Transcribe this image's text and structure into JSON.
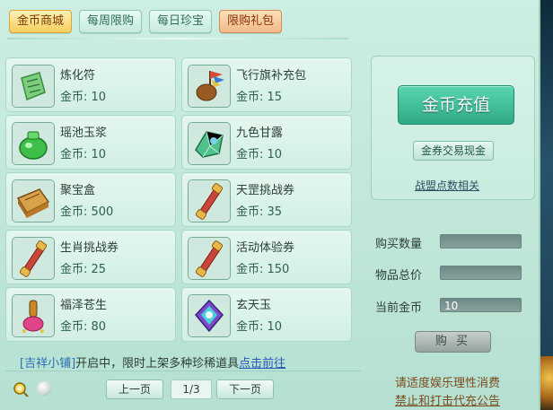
{
  "tabs": [
    {
      "label": "金币商城",
      "active": true
    },
    {
      "label": "每周限购",
      "active": false
    },
    {
      "label": "每日珍宝",
      "active": false
    },
    {
      "label": "限购礼包",
      "active": false
    }
  ],
  "items": [
    {
      "name": "炼化符",
      "price": "金币: 10",
      "icon": "talisman-icon"
    },
    {
      "name": "飞行旗补充包",
      "price": "金币: 15",
      "icon": "flag-pack-icon"
    },
    {
      "name": "瑶池玉浆",
      "price": "金币: 10",
      "icon": "jade-jar-icon"
    },
    {
      "name": "九色甘露",
      "price": "金币: 10",
      "icon": "dew-crystal-icon"
    },
    {
      "name": "聚宝盒",
      "price": "金币: 500",
      "icon": "treasure-box-icon"
    },
    {
      "name": "天罡挑战券",
      "price": "金币: 35",
      "icon": "scroll-icon"
    },
    {
      "name": "生肖挑战券",
      "price": "金币: 25",
      "icon": "scroll-icon"
    },
    {
      "name": "活动体验券",
      "price": "金币: 150",
      "icon": "scroll-icon"
    },
    {
      "name": "福泽苍生",
      "price": "金币: 80",
      "icon": "gourd-bottle-icon"
    },
    {
      "name": "玄天玉",
      "price": "金币: 10",
      "icon": "purple-jade-icon"
    }
  ],
  "side": {
    "recharge_label": "金币充值",
    "exchange_label": "金券交易现金",
    "alliance_link": "战盟点数相关"
  },
  "form": {
    "quantity_label": "购买数量",
    "quantity_value": "",
    "total_label": "物品总价",
    "total_value": "",
    "current_label": "当前金币",
    "current_value": "10",
    "buy_label": "购 买"
  },
  "notice": {
    "shop": "[吉祥小铺]",
    "text": "开启中，限时上架多种珍稀道具",
    "link": "点击前往"
  },
  "pager": {
    "prev": "上一页",
    "page": "1/3",
    "next": "下一页"
  },
  "footer": {
    "line1": "请适度娱乐理性消费",
    "line2": "禁止和打击代充公告"
  },
  "colors": {
    "accent": "#2fa983",
    "active_tab": "#f6cf5e",
    "panel_bg": "#cdeee2"
  }
}
